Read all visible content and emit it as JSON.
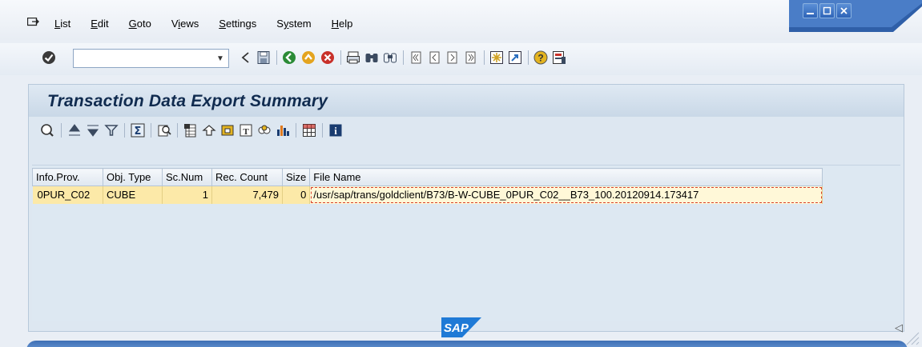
{
  "menubar": {
    "items": [
      {
        "label": "List",
        "mnemonic": "L",
        "rest": "ist"
      },
      {
        "label": "Edit",
        "mnemonic": "E",
        "rest": "dit"
      },
      {
        "label": "Goto",
        "mnemonic": "G",
        "rest": "oto"
      },
      {
        "pre": "V",
        "mnemonic": "i",
        "rest": "ews",
        "label": "Views"
      },
      {
        "label": "Settings",
        "mnemonic": "S",
        "rest": "ettings"
      },
      {
        "pre": "S",
        "mnemonic": "y",
        "rest": "stem",
        "label": "System"
      },
      {
        "label": "Help",
        "mnemonic": "H",
        "rest": "elp"
      }
    ]
  },
  "command_field": {
    "value": ""
  },
  "panel": {
    "title": "Transaction Data Export Summary"
  },
  "grid": {
    "columns": [
      "Info.Prov.",
      "Obj. Type",
      "Sc.Num",
      "Rec. Count",
      "Size",
      "File Name"
    ],
    "rows": [
      {
        "info_prov": "0PUR_C02",
        "obj_type": "CUBE",
        "sc_num": "1",
        "rec_count": "7,479",
        "size": "0",
        "file_name": "/usr/sap/trans/goldclient/B73/B-W-CUBE_0PUR_C02__B73_100.20120914.173417"
      }
    ]
  },
  "footer": {
    "logo_text": "SAP"
  },
  "colors": {
    "row_highlight": "#fce9a8",
    "title_text": "#102b4f",
    "status_bar": "#3e6fb5"
  }
}
